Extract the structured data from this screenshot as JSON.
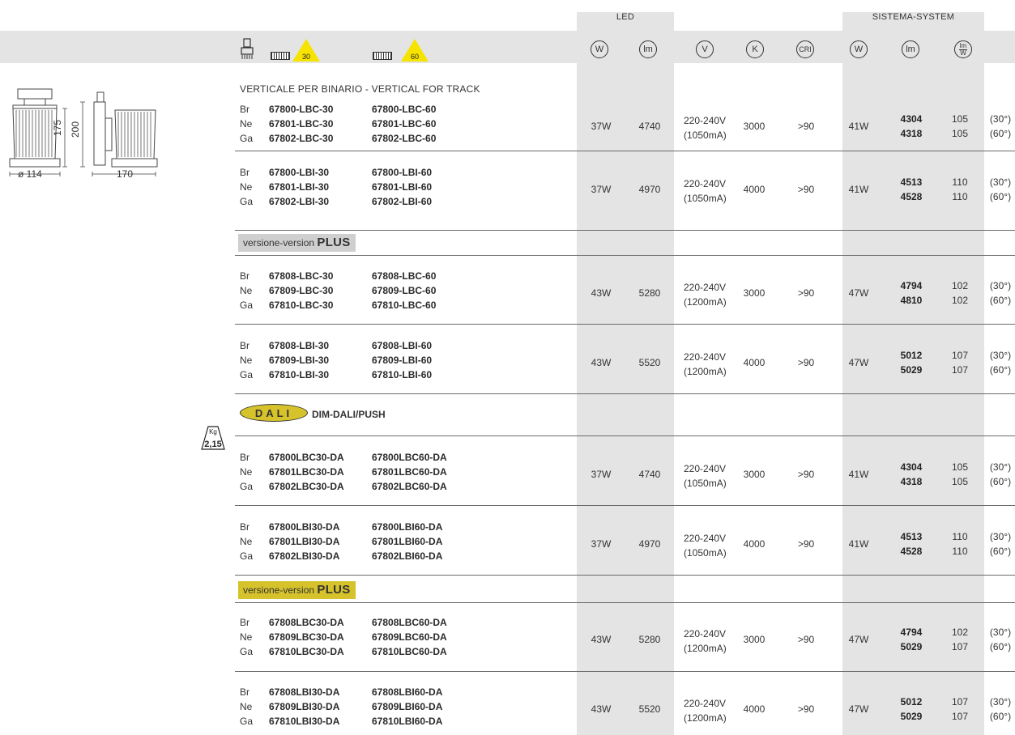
{
  "header": {
    "led_title": "LED",
    "system_title": "SISTEMA-SYSTEM",
    "beam_30": "30",
    "beam_60": "60",
    "icons": {
      "led_watt": "W",
      "led_lumen": "lm",
      "volt": "V",
      "kelvin": "K",
      "cri": "CRI",
      "sys_watt": "W",
      "sys_lumen": "lm",
      "efficacy_top": "lm",
      "efficacy_bottom": "W"
    }
  },
  "drawing": {
    "dim_175": "175",
    "dim_200": "200",
    "dim_114": "ø 114",
    "dim_170": "170"
  },
  "weight": {
    "unit": "Kg",
    "value": "2,15"
  },
  "group_title": "VERTICALE PER BINARIO - VERTICAL FOR TRACK",
  "plus_label_prefix": "versione-version",
  "plus_label_bold": "PLUS",
  "dali_logo": "DALI",
  "dali_text": "DIM-DALI/PUSH",
  "colors": {
    "shade": "#e4e4e4",
    "triangle": "#f7e300",
    "plus_gray": "#cfcfcf",
    "plus_gold": "#d6c32b"
  },
  "rows": [
    {
      "labels": [
        "Br",
        "Ne",
        "Ga"
      ],
      "codes30": [
        "67800-LBC-30",
        "67801-LBC-30",
        "67802-LBC-30"
      ],
      "codes60": [
        "67800-LBC-60",
        "67801-LBC-60",
        "67802-LBC-60"
      ],
      "led_w": "37W",
      "led_lm": "4740",
      "volt": "220-240V",
      "ma": "(1050mA)",
      "k": "3000",
      "cri": ">90",
      "sys_w": "41W",
      "sys_lm": [
        "4304",
        "4318"
      ],
      "eff": [
        "105",
        "105"
      ],
      "beam": [
        "(30°)",
        "(60°)"
      ]
    },
    {
      "labels": [
        "Br",
        "Ne",
        "Ga"
      ],
      "codes30": [
        "67800-LBI-30",
        "67801-LBI-30",
        "67802-LBI-30"
      ],
      "codes60": [
        "67800-LBI-60",
        "67801-LBI-60",
        "67802-LBI-60"
      ],
      "led_w": "37W",
      "led_lm": "4970",
      "volt": "220-240V",
      "ma": "(1050mA)",
      "k": "4000",
      "cri": ">90",
      "sys_w": "41W",
      "sys_lm": [
        "4513",
        "4528"
      ],
      "eff": [
        "110",
        "110"
      ],
      "beam": [
        "(30°)",
        "(60°)"
      ]
    },
    {
      "labels": [
        "Br",
        "Ne",
        "Ga"
      ],
      "codes30": [
        "67808-LBC-30",
        "67809-LBC-30",
        "67810-LBC-30"
      ],
      "codes60": [
        "67808-LBC-60",
        "67809-LBC-60",
        "67810-LBC-60"
      ],
      "led_w": "43W",
      "led_lm": "5280",
      "volt": "220-240V",
      "ma": "(1200mA)",
      "k": "3000",
      "cri": ">90",
      "sys_w": "47W",
      "sys_lm": [
        "4794",
        "4810"
      ],
      "eff": [
        "102",
        "102"
      ],
      "beam": [
        "(30°)",
        "(60°)"
      ]
    },
    {
      "labels": [
        "Br",
        "Ne",
        "Ga"
      ],
      "codes30": [
        "67808-LBI-30",
        "67809-LBI-30",
        "67810-LBI-30"
      ],
      "codes60": [
        "67808-LBI-60",
        "67809-LBI-60",
        "67810-LBI-60"
      ],
      "led_w": "43W",
      "led_lm": "5520",
      "volt": "220-240V",
      "ma": "(1200mA)",
      "k": "4000",
      "cri": ">90",
      "sys_w": "47W",
      "sys_lm": [
        "5012",
        "5029"
      ],
      "eff": [
        "107",
        "107"
      ],
      "beam": [
        "(30°)",
        "(60°)"
      ]
    },
    {
      "labels": [
        "Br",
        "Ne",
        "Ga"
      ],
      "codes30": [
        "67800LBC30-DA",
        "67801LBC30-DA",
        "67802LBC30-DA"
      ],
      "codes60": [
        "67800LBC60-DA",
        "67801LBC60-DA",
        "67802LBC60-DA"
      ],
      "led_w": "37W",
      "led_lm": "4740",
      "volt": "220-240V",
      "ma": "(1050mA)",
      "k": "3000",
      "cri": ">90",
      "sys_w": "41W",
      "sys_lm": [
        "4304",
        "4318"
      ],
      "eff": [
        "105",
        "105"
      ],
      "beam": [
        "(30°)",
        "(60°)"
      ]
    },
    {
      "labels": [
        "Br",
        "Ne",
        "Ga"
      ],
      "codes30": [
        "67800LBI30-DA",
        "67801LBI30-DA",
        "67802LBI30-DA"
      ],
      "codes60": [
        "67800LBI60-DA",
        "67801LBI60-DA",
        "67802LBI60-DA"
      ],
      "led_w": "37W",
      "led_lm": "4970",
      "volt": "220-240V",
      "ma": "(1050mA)",
      "k": "4000",
      "cri": ">90",
      "sys_w": "41W",
      "sys_lm": [
        "4513",
        "4528"
      ],
      "eff": [
        "110",
        "110"
      ],
      "beam": [
        "(30°)",
        "(60°)"
      ]
    },
    {
      "labels": [
        "Br",
        "Ne",
        "Ga"
      ],
      "codes30": [
        "67808LBC30-DA",
        "67809LBC30-DA",
        "67810LBC30-DA"
      ],
      "codes60": [
        "67808LBC60-DA",
        "67809LBC60-DA",
        "67810LBC60-DA"
      ],
      "led_w": "43W",
      "led_lm": "5280",
      "volt": "220-240V",
      "ma": "(1200mA)",
      "k": "3000",
      "cri": ">90",
      "sys_w": "47W",
      "sys_lm": [
        "4794",
        "5029"
      ],
      "eff": [
        "102",
        "107"
      ],
      "beam": [
        "(30°)",
        "(60°)"
      ]
    },
    {
      "labels": [
        "Br",
        "Ne",
        "Ga"
      ],
      "codes30": [
        "67808LBI30-DA",
        "67809LBI30-DA",
        "67810LBI30-DA"
      ],
      "codes60": [
        "67808LBI60-DA",
        "67809LBI60-DA",
        "67810LBI60-DA"
      ],
      "led_w": "43W",
      "led_lm": "5520",
      "volt": "220-240V",
      "ma": "(1200mA)",
      "k": "4000",
      "cri": ">90",
      "sys_w": "47W",
      "sys_lm": [
        "5012",
        "5029"
      ],
      "eff": [
        "107",
        "107"
      ],
      "beam": [
        "(30°)",
        "(60°)"
      ]
    }
  ]
}
